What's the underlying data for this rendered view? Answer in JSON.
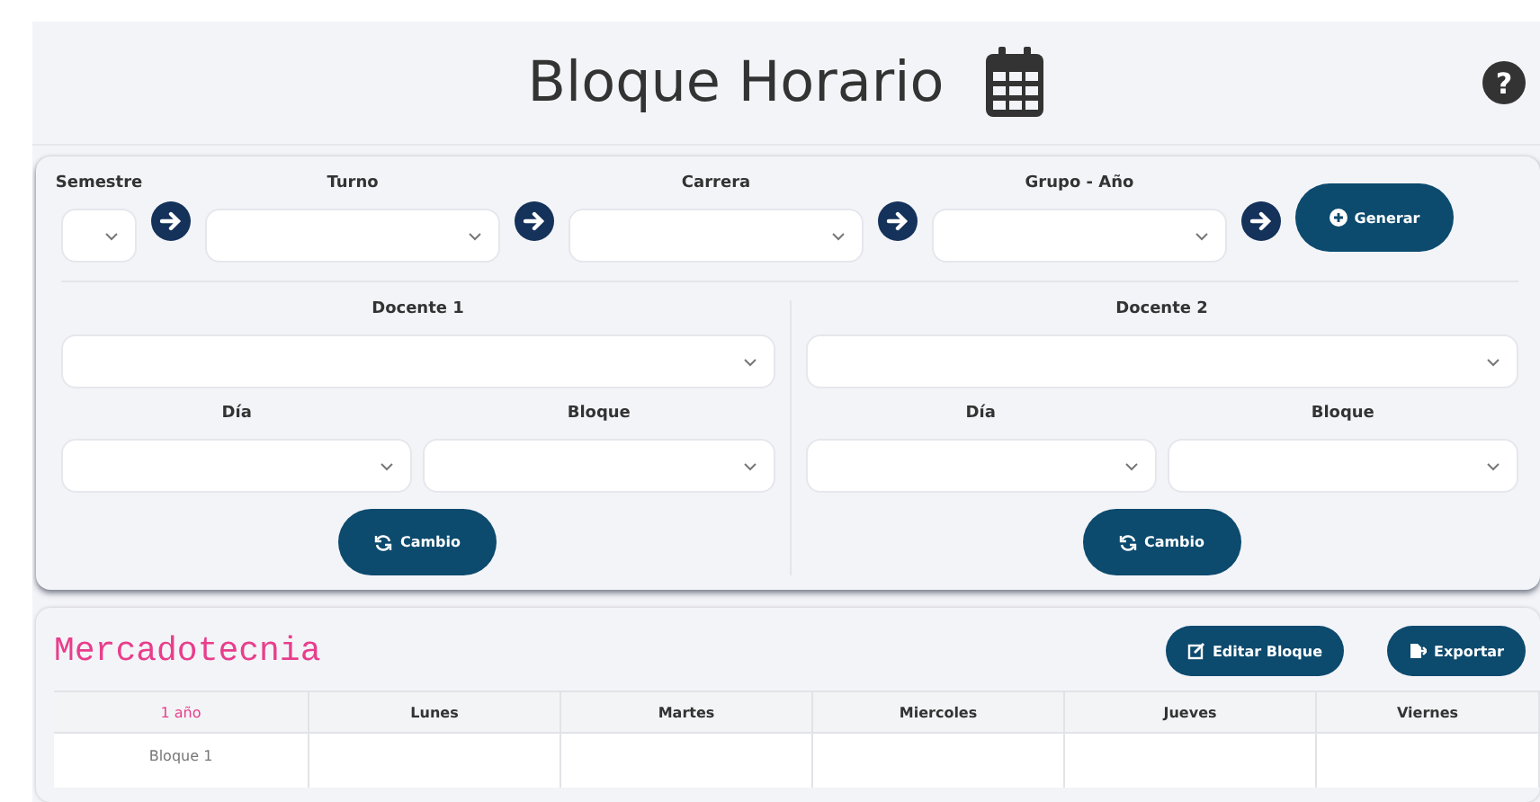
{
  "header": {
    "title": "Bloque Horario",
    "help": "?"
  },
  "filters": [
    {
      "label": "Semestre",
      "kind": "compact"
    },
    {
      "label": "Turno",
      "kind": "wide"
    },
    {
      "label": "Carrera",
      "kind": "wide"
    },
    {
      "label": "Grupo - Año",
      "kind": "wide"
    }
  ],
  "generate_button": "Generar",
  "teachers": [
    {
      "label": "Docente 1",
      "day_label": "Día",
      "block_label": "Bloque",
      "button": "Cambio"
    },
    {
      "label": "Docente 2",
      "day_label": "Día",
      "block_label": "Bloque",
      "button": "Cambio"
    }
  ],
  "schedule": {
    "title": "Mercadotecnia",
    "buttons": [
      {
        "label": "Editar Bloque",
        "kind": "edit"
      },
      {
        "label": "Exportar",
        "kind": "export"
      }
    ],
    "columns": [
      "1 año",
      "Lunes",
      "Martes",
      "Miercoles",
      "Jueves",
      "Viernes"
    ],
    "rows": [
      {
        "label": "Bloque 1"
      }
    ]
  }
}
